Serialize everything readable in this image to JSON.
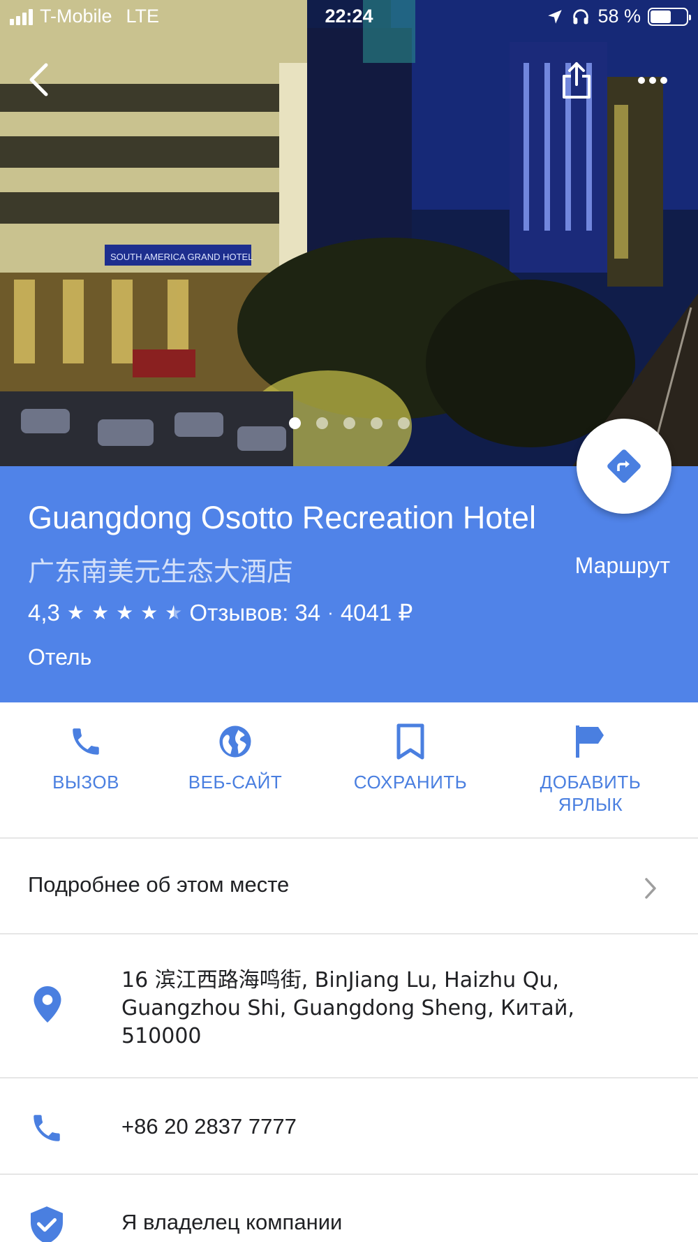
{
  "status_bar": {
    "carrier": "T-Mobile",
    "network": "LTE",
    "time": "22:24",
    "battery_text": "58 %",
    "battery_level": 0.58
  },
  "gallery": {
    "photo_count": 5,
    "active_index": 0,
    "photo_sign_text": "SOUTH AMERICA GRAND HOTEL"
  },
  "place": {
    "name": "Guangdong Osotto Recreation Hotel",
    "native_name": "广东南美元生态大酒店",
    "rating": "4,3",
    "rating_value": 4.3,
    "reviews_text": "Отзывов: 34",
    "separator": "·",
    "price": "4041 ₽",
    "category": "Отель",
    "route_label": "Маршрут"
  },
  "actions": [
    {
      "id": "call",
      "label": "ВЫЗОВ",
      "icon": "phone-icon"
    },
    {
      "id": "website",
      "label": "ВЕБ-САЙТ",
      "icon": "globe-icon"
    },
    {
      "id": "save",
      "label": "СОХРАНИТЬ",
      "icon": "bookmark-icon"
    },
    {
      "id": "label",
      "label": "ДОБАВИТЬ\nЯРЛЫК",
      "icon": "flag-icon"
    }
  ],
  "details": {
    "more_info": "Подробнее об этом месте",
    "address": "16 滨江西路海鸣街, BinJiang Lu, Haizhu Qu, Guangzhou Shi, Guangdong Sheng, Китай, 510000",
    "phone": "+86 20 2837 7777",
    "owner": "Я владелец компании"
  },
  "colors": {
    "header_blue": "#5083e8",
    "accent_blue": "#4a7fe0"
  }
}
